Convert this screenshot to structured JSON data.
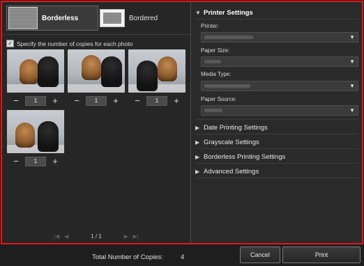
{
  "layout": {
    "options": [
      {
        "label": "Borderless",
        "selected": true
      },
      {
        "label": "Bordered",
        "selected": false
      }
    ]
  },
  "copies_option": {
    "label": "Specify the number of copies for each photo",
    "checked": true
  },
  "photos": [
    {
      "copies": "1"
    },
    {
      "copies": "1"
    },
    {
      "copies": "1"
    },
    {
      "copies": "1"
    }
  ],
  "pager": {
    "text": "1 / 1"
  },
  "printer_settings": {
    "title": "Printer Settings",
    "fields": [
      {
        "label": "Printer:"
      },
      {
        "label": "Paper Size:"
      },
      {
        "label": "Media Type:"
      },
      {
        "label": "Paper Source:"
      }
    ]
  },
  "collapsed_sections": [
    "Date Printing Settings",
    "Grayscale Settings",
    "Borderless Printing Settings",
    "Advanced Settings"
  ],
  "footer": {
    "total_label": "Total Number of Copies:",
    "total_value": "4",
    "cancel_label": "Cancel",
    "print_label": "Print"
  },
  "colors": {
    "highlight_border": "#e01818",
    "background": "#262626"
  }
}
